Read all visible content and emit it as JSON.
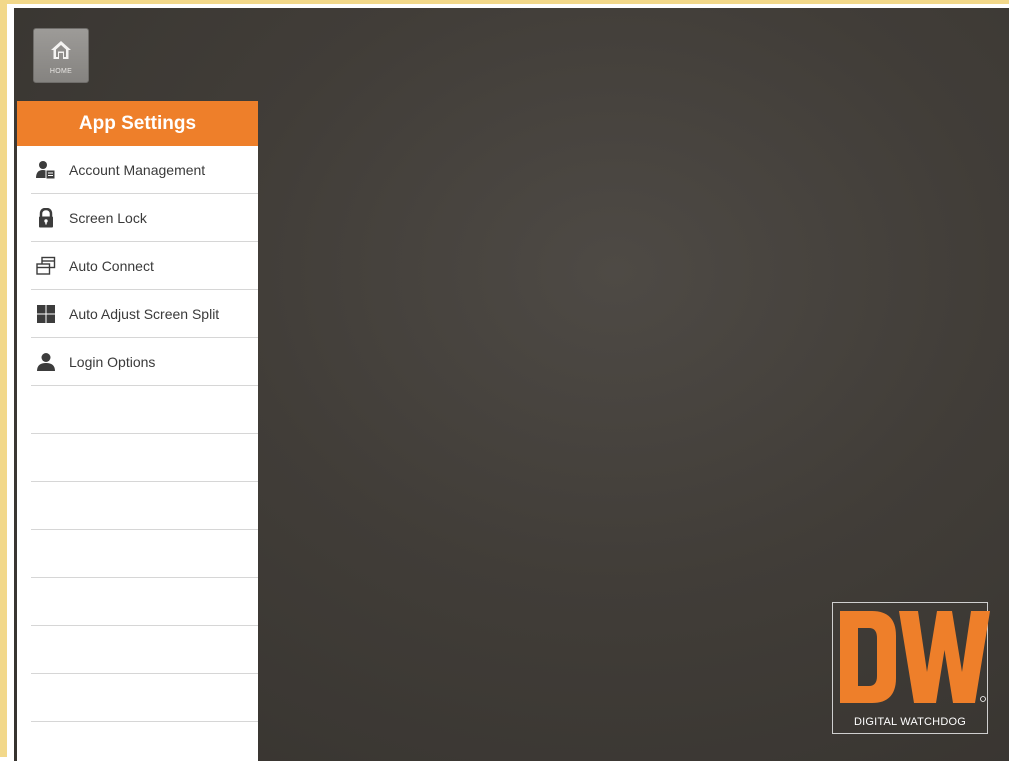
{
  "home": {
    "label": "HOME",
    "icon": "home-icon"
  },
  "panel": {
    "title": "App Settings",
    "header_color": "#ee7f2a",
    "items": [
      {
        "label": "Account Management",
        "icon": "account-management-icon"
      },
      {
        "label": "Screen Lock",
        "icon": "lock-icon"
      },
      {
        "label": "Auto Connect",
        "icon": "auto-connect-icon"
      },
      {
        "label": "Auto Adjust Screen Split",
        "icon": "screen-split-icon"
      },
      {
        "label": "Login Options",
        "icon": "user-icon"
      }
    ]
  },
  "logo": {
    "text": "DIGITAL WATCHDOG",
    "mark": "DW",
    "color": "#ee7f2a"
  }
}
